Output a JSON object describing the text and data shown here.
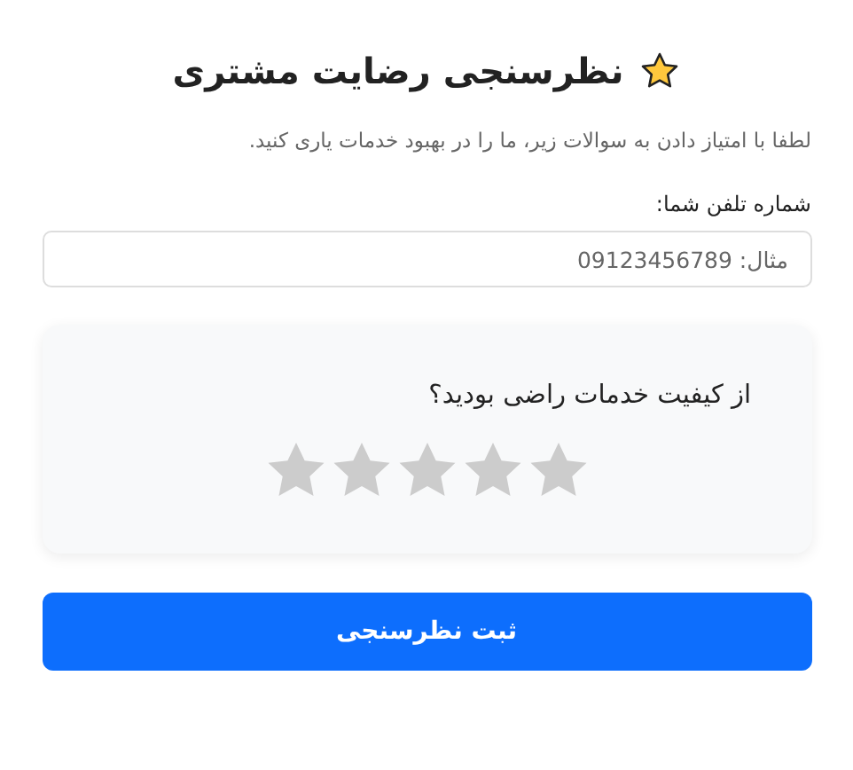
{
  "title": "نظرسنجی رضایت مشتری",
  "intro": "لطفا با امتیاز دادن به سوالات زیر، ما را در بهبود خدمات یاری کنید.",
  "phone": {
    "label": "شماره تلفن شما:",
    "placeholder": "مثال: 09123456789"
  },
  "question": {
    "text": "از کیفیت خدمات راضی بودید؟",
    "stars": 0
  },
  "submit": "ثبت نظرسنجی"
}
